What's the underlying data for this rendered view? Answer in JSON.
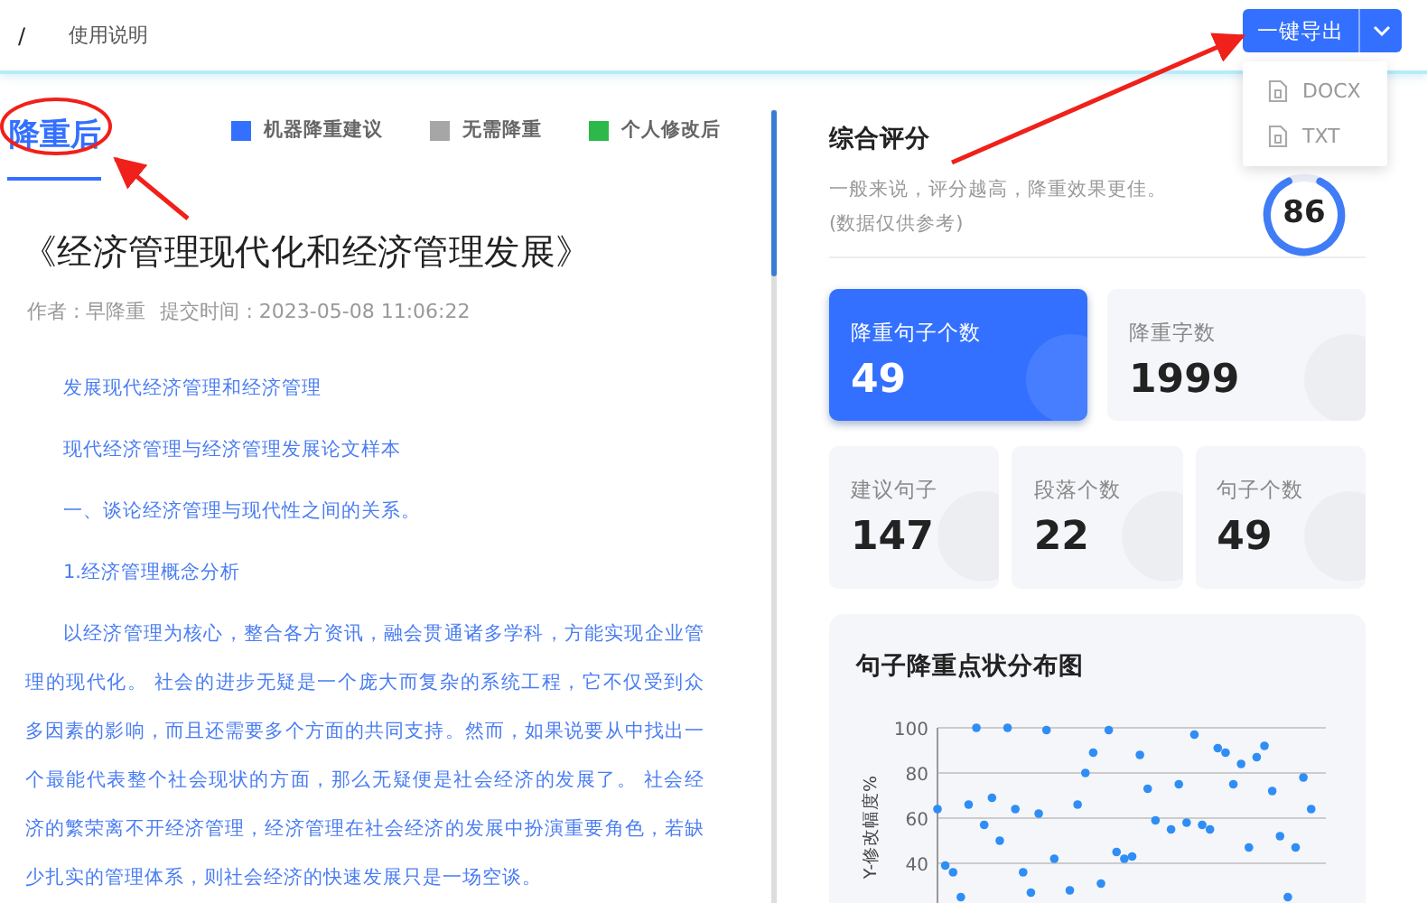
{
  "topbar": {
    "separator": "/",
    "link": "使用说明",
    "export_button": "一键导出",
    "export_menu": {
      "expanded": true,
      "items": [
        "DOCX",
        "TXT"
      ]
    }
  },
  "document": {
    "tab": {
      "label": "降重后",
      "selected": true
    },
    "legend": [
      {
        "label": "机器降重建议",
        "color": "#3370ff"
      },
      {
        "label": "无需降重",
        "color": "#a6a6a6"
      },
      {
        "label": "个人修改后",
        "color": "#2db84a"
      }
    ],
    "title": "《经济管理现代化和经济管理发展》",
    "author": "作者 : 早降重",
    "submitted": "提交时间 : 2023-05-08 11:06:22",
    "paragraphs": [
      "发展现代经济管理和经济管理",
      "现代经济管理与经济管理发展论文样本",
      "一、谈论经济管理与现代性之间的关系。",
      "1.经济管理概念分析",
      "以经济管理为核心，整合各方资讯，融会贯通诸多学科，方能实现企业管理的现代化。 社会的进步无疑是一个庞大而复杂的系统工程，它不仅受到众多因素的影响，而且还需要多个方面的共同支持。然而，如果说要从中找出一个最能代表整个社会现状的方面，那么无疑便是社会经济的发展了。 社会经济的繁荣离不开经济管理，经济管理在社会经济的发展中扮演重要角色，若缺少扎实的管理体系，则社会经济的快速发展只是一场空谈。"
    ]
  },
  "score": {
    "title": "综合评分",
    "description": "一般来说，评分越高，降重效果更佳。(数据仅供参考)",
    "value": "86",
    "level": 0.86
  },
  "stats": [
    {
      "label": "降重句子个数",
      "value": "49",
      "selected": true
    },
    {
      "label": "降重字数",
      "value": "1999",
      "selected": false
    },
    {
      "label": "建议句子",
      "value": "147",
      "selected": false
    },
    {
      "label": "段落个数",
      "value": "22",
      "selected": false
    },
    {
      "label": "句子个数",
      "value": "49",
      "selected": false
    }
  ],
  "chart": {
    "title": "句子降重点状分布图",
    "ylabel": "Y-修改幅度%",
    "tick_labels": [
      "100",
      "80",
      "60",
      "40"
    ]
  }
}
